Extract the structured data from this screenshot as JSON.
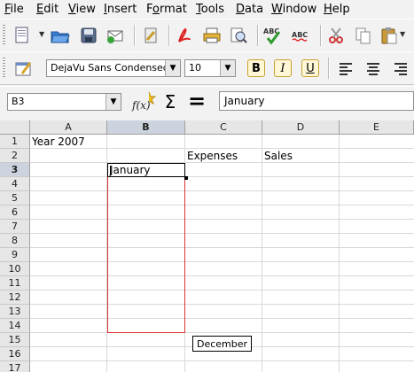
{
  "menu": [
    "File",
    "Edit",
    "View",
    "Insert",
    "Format",
    "Tools",
    "Data",
    "Window",
    "Help"
  ],
  "menu_underline": [
    "F",
    "E",
    "V",
    "I",
    "o",
    "T",
    "D",
    "W",
    "H"
  ],
  "toolbar": {
    "font_name": "DejaVu Sans Condensed",
    "font_size": "10",
    "bold_label": "B",
    "italic_label": "I",
    "underline_label": "U",
    "spell_label_1": "ABC",
    "spell_label_2": "ABC"
  },
  "formula_bar": {
    "name_box": "B3",
    "function_wizard_label": "f(x)",
    "sum_label": "Σ",
    "equals_label": "=",
    "input": "January"
  },
  "grid": {
    "columns": [
      "A",
      "B",
      "C",
      "D",
      "E"
    ],
    "rows": [
      "1",
      "2",
      "3",
      "4",
      "5",
      "6",
      "7",
      "8",
      "9",
      "10",
      "11",
      "12",
      "13",
      "14",
      "15",
      "16",
      "17"
    ],
    "cells": {
      "A1": "Year 2007",
      "C2": "Expenses",
      "D2": "Sales",
      "B3": "January"
    },
    "autofill_tooltip": "December"
  }
}
